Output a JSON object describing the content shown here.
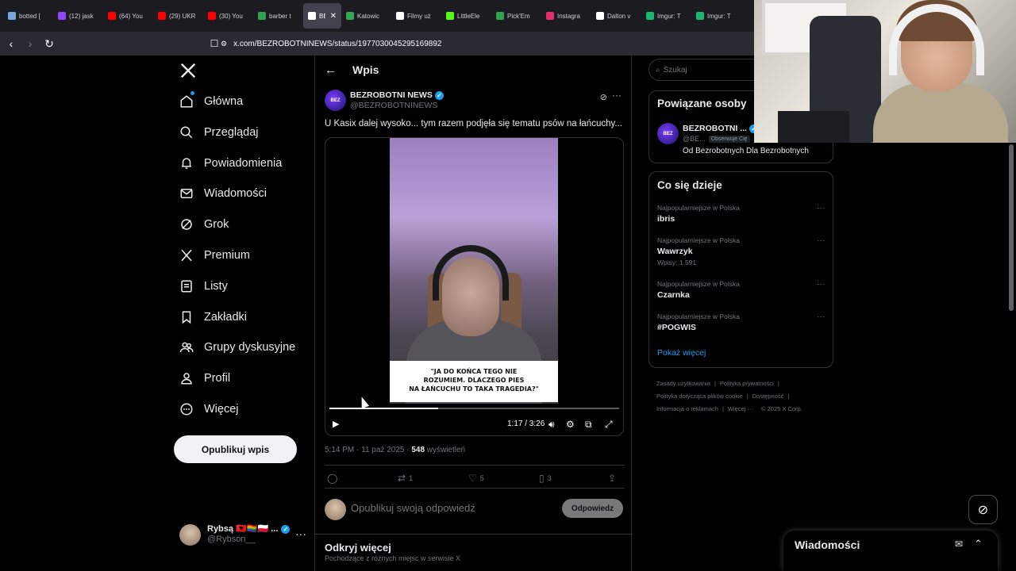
{
  "browser": {
    "tabs": [
      {
        "label": "botted [",
        "color": "#7aa6d9"
      },
      {
        "label": "(12) jask",
        "color": "#9146ff"
      },
      {
        "label": "(64) You",
        "color": "#ff0000"
      },
      {
        "label": "(29) UKR",
        "color": "#ff0000"
      },
      {
        "label": "(30) You",
        "color": "#ff0000"
      },
      {
        "label": "barber t",
        "color": "#2ea44f"
      },
      {
        "label": "BEZ",
        "color": "#ffffff",
        "active": true
      },
      {
        "label": "Katowic",
        "color": "#34a853"
      },
      {
        "label": "Filmy uż",
        "color": "#ffffff"
      },
      {
        "label": "LittleEle",
        "color": "#53fc18"
      },
      {
        "label": "Pick'Em",
        "color": "#2ea44f"
      },
      {
        "label": "Instagra",
        "color": "#e1306c"
      },
      {
        "label": "Dalton v",
        "color": "#ffffff"
      },
      {
        "label": "Imgur: T",
        "color": "#1bb76e"
      },
      {
        "label": "Imgur: T",
        "color": "#1bb76e"
      }
    ],
    "url": "x.com/BEZROBOTNINEWS/status/1977030045295169892"
  },
  "leftnav": {
    "items": [
      {
        "label": "Główna",
        "icon": "home-icon"
      },
      {
        "label": "Przeglądaj",
        "icon": "search-icon"
      },
      {
        "label": "Powiadomienia",
        "icon": "bell-icon"
      },
      {
        "label": "Wiadomości",
        "icon": "envelope-icon"
      },
      {
        "label": "Grok",
        "icon": "grok-icon"
      },
      {
        "label": "Premium",
        "icon": "x-logo-icon"
      },
      {
        "label": "Listy",
        "icon": "list-icon"
      },
      {
        "label": "Zakładki",
        "icon": "bookmark-icon"
      },
      {
        "label": "Grupy dyskusyjne",
        "icon": "people-icon"
      },
      {
        "label": "Profil",
        "icon": "person-icon"
      },
      {
        "label": "Więcej",
        "icon": "more-circle-icon"
      }
    ],
    "post_button": "Opublikuj wpis",
    "account": {
      "name": "Rybsą 🇦🇱🏳️‍🌈🇵🇱 ...",
      "handle": "@Rybson__"
    }
  },
  "center": {
    "header_title": "Wpis",
    "author": {
      "name": "BEZROBOTNI NEWS",
      "handle": "@BEZROBOTNINEWS",
      "avatar_text": "BEZ"
    },
    "text": "U Kasix dalej wysoko... tym razem podjęła się tematu psów na łańcuchy...",
    "video": {
      "caption_line1": "\"JA DO KOŃCA TEGO NIE",
      "caption_line2": "ROZUMIEM. DLACZEGO PIES",
      "caption_line3": "NA ŁAŃCUCHU TO TAKA TRAGEDIA?\"",
      "time": "1:17 / 3:26",
      "progress": 0.374
    },
    "meta": {
      "time": "5:14 PM · 11 paź 2025 · ",
      "views": "548",
      "views_label": " wyświetleń"
    },
    "actions": {
      "retweets": "1",
      "likes": "5",
      "bookmarks": "3"
    },
    "reply_placeholder": "Opublikuj swoją odpowiedź",
    "reply_button": "Odpowiedz",
    "discover_title": "Odkryj więcej",
    "discover_sub": "Pochodzące z różnych miejsc w serwisie X"
  },
  "right": {
    "search_placeholder": "Szukaj",
    "related": {
      "title": "Powiązane osoby",
      "name": "BEZROBOTNI ...",
      "handle": "@BE...",
      "follows_you": "Obserwuje Cię",
      "bio": "Od Bezrobotnych Dla Bezrobotnych"
    },
    "trends": {
      "title": "Co się dzieje",
      "items": [
        {
          "context": "Najpopularniejsze w Polska",
          "name": "ibris",
          "count": ""
        },
        {
          "context": "Najpopularniejsze w Polska",
          "name": "Wawrzyk",
          "count": "Wpisy: 1 591"
        },
        {
          "context": "Najpopularniejsze w Polska",
          "name": "Czarnka",
          "count": ""
        },
        {
          "context": "Najpopularniejsze w Polska",
          "name": "#POGWIS",
          "count": ""
        }
      ],
      "show_more": "Pokaż więcej"
    },
    "footer": {
      "terms": "Zasady użytkowania",
      "privacy": "Polityka prywatności",
      "cookies": "Polityka dotycząca plików cookie",
      "accessibility": "Dostępność",
      "ads": "Informacja o reklamach",
      "more": "Więcej ···",
      "copyright": "© 2025 X Corp."
    },
    "messages_title": "Wiadomości"
  }
}
